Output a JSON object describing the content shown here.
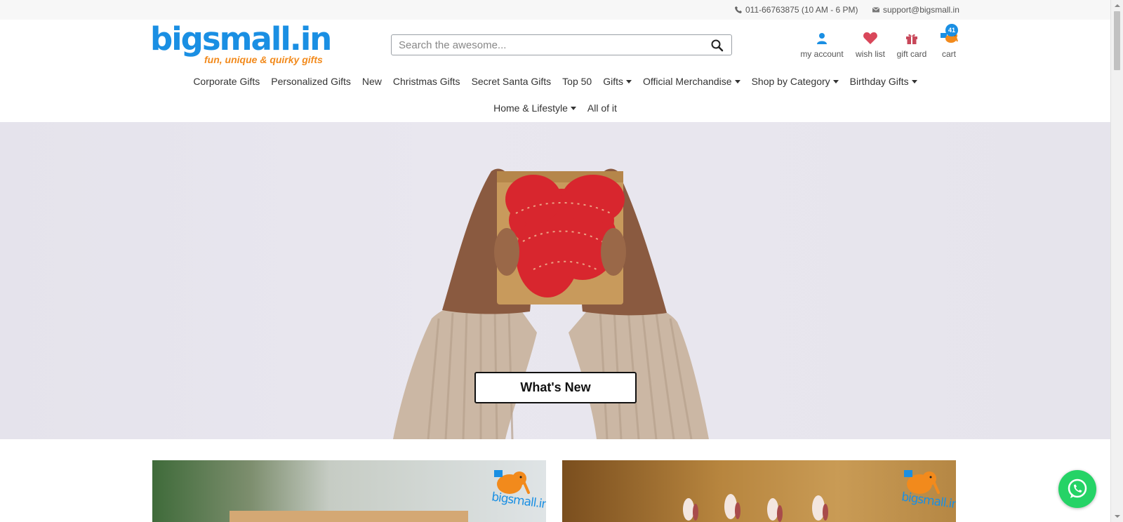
{
  "topbar": {
    "phone": "011-66763875 (10 AM - 6 PM)",
    "email": "support@bigsmall.in"
  },
  "logo": {
    "name": "bigsmall.in",
    "tagline": "fun, unique & quirky gifts"
  },
  "search": {
    "placeholder": "Search the awesome..."
  },
  "account_links": {
    "my_account": "my account",
    "wish_list": "wish list",
    "gift_card": "gift card",
    "cart": "cart",
    "cart_count": "41"
  },
  "nav": {
    "row1": [
      {
        "label": "Corporate Gifts",
        "dropdown": false
      },
      {
        "label": "Personalized Gifts",
        "dropdown": false
      },
      {
        "label": "New",
        "dropdown": false
      },
      {
        "label": "Christmas Gifts",
        "dropdown": false
      },
      {
        "label": "Secret Santa Gifts",
        "dropdown": false
      },
      {
        "label": "Top 50",
        "dropdown": false
      },
      {
        "label": "Gifts",
        "dropdown": true
      },
      {
        "label": "Official Merchandise",
        "dropdown": true
      },
      {
        "label": "Shop by Category",
        "dropdown": true
      },
      {
        "label": "Birthday Gifts",
        "dropdown": true
      }
    ],
    "row2": [
      {
        "label": "Home & Lifestyle",
        "dropdown": true
      },
      {
        "label": "All of it",
        "dropdown": false
      }
    ]
  },
  "hero": {
    "button_label": "What's New"
  },
  "tiles": {
    "logo_text": "bigsmall.in"
  },
  "colors": {
    "brand_blue": "#1a8fe3",
    "brand_orange": "#f28a1c",
    "whatsapp_green": "#25d366"
  }
}
